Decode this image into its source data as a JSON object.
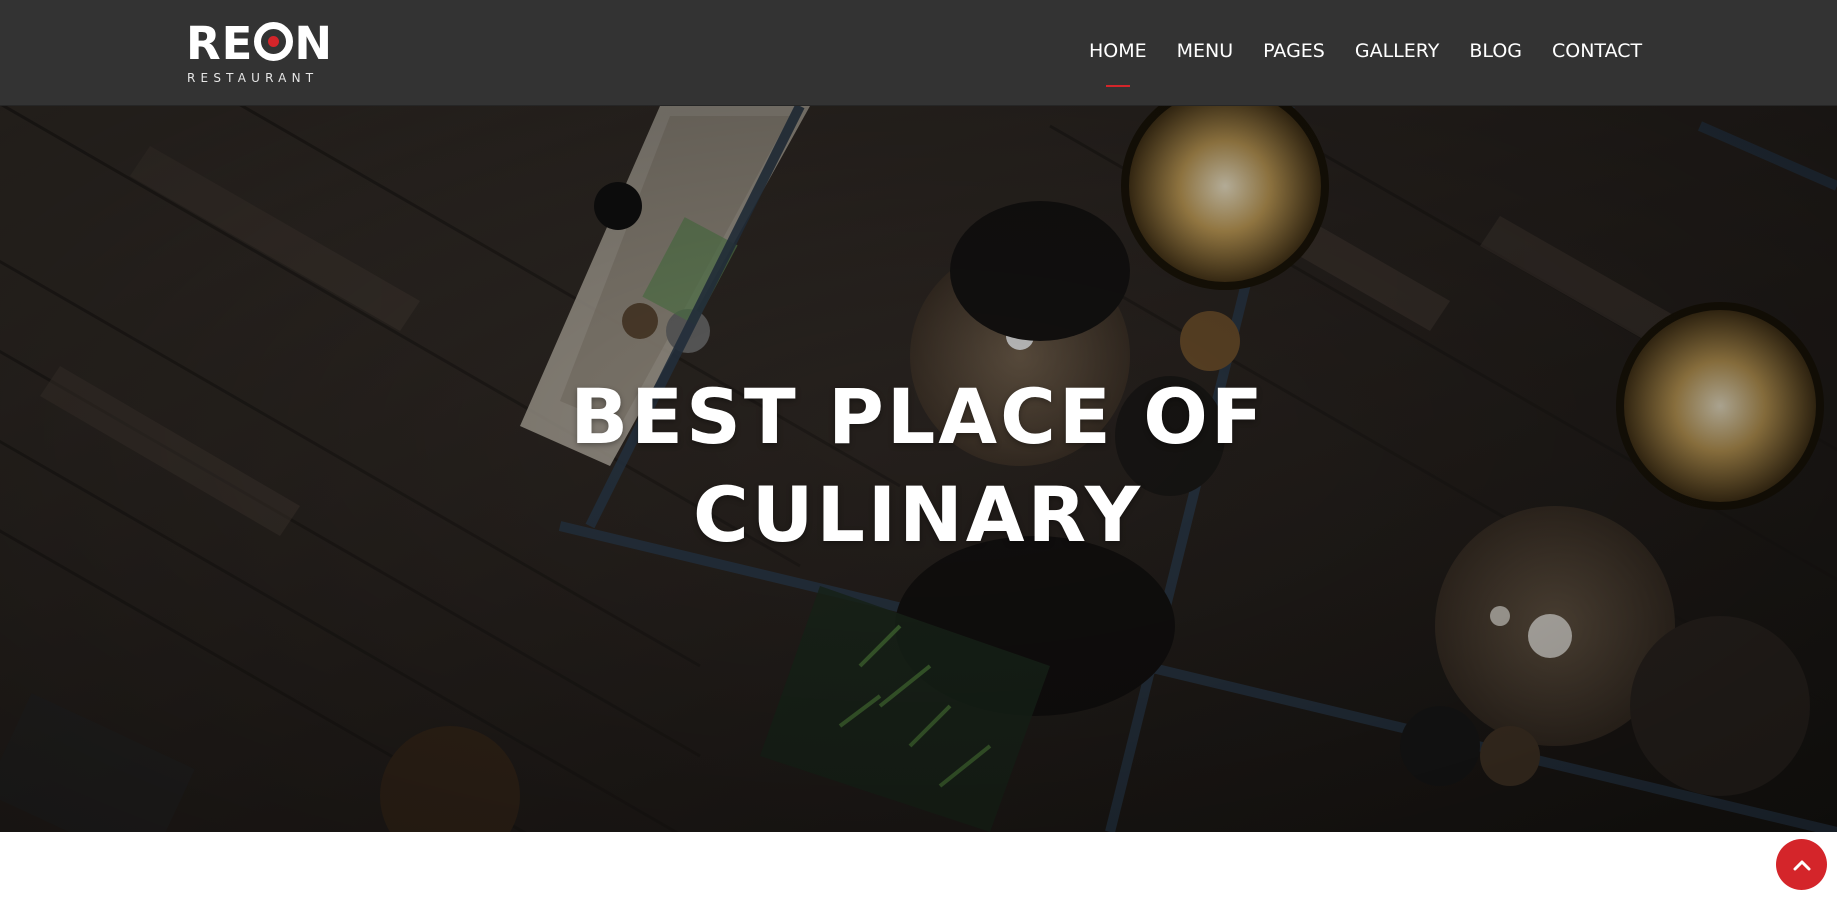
{
  "brand": {
    "name_left": "RE",
    "name_right": "N",
    "tagline": "RESTAURANT",
    "accent_color": "#d4252a"
  },
  "nav": {
    "items": [
      {
        "label": "HOME",
        "active": true
      },
      {
        "label": "MENU",
        "active": false
      },
      {
        "label": "PAGES",
        "active": false
      },
      {
        "label": "GALLERY",
        "active": false
      },
      {
        "label": "BLOG",
        "active": false
      },
      {
        "label": "CONTACT",
        "active": false
      }
    ]
  },
  "hero": {
    "title_line1": "BEST PLACE OF",
    "title_line2": "CULINARY"
  },
  "scroll_top": {
    "icon": "chevron-up-icon"
  }
}
